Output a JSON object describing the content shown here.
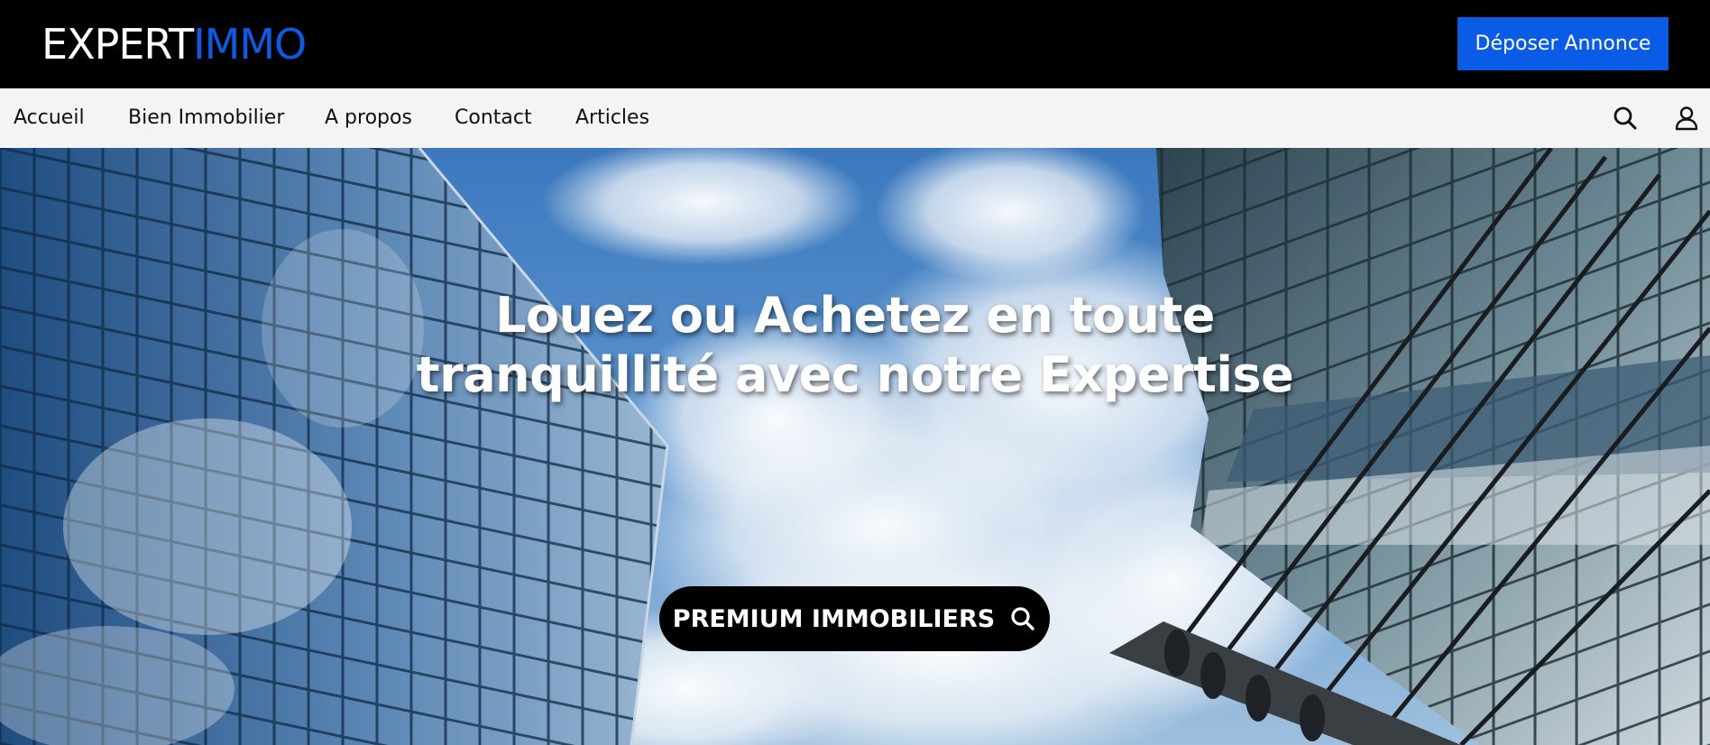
{
  "header": {
    "logo_part1": "EXPERT",
    "logo_part2": "IMMO",
    "cta_label": "Déposer Annonce"
  },
  "nav": {
    "items": [
      {
        "label": "Accueil"
      },
      {
        "label": "Bien Immobilier"
      },
      {
        "label": "A propos"
      },
      {
        "label": "Contact"
      },
      {
        "label": "Articles"
      }
    ],
    "icons": [
      "search-icon",
      "user-icon"
    ]
  },
  "hero": {
    "title_line1": "Louez ou Achetez en toute",
    "title_line2": "tranquillité avec notre Expertise",
    "button_label": "PREMIUM IMMOBILIERS",
    "button_icon": "search-icon"
  },
  "colors": {
    "brand_accent": "#0a5ce6",
    "topbar_bg": "#000000",
    "navbar_bg": "#f4f4f4",
    "hero_button_bg": "#000000"
  }
}
